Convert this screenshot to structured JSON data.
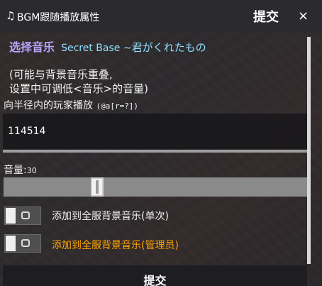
{
  "window": {
    "title": "BGM跟随播放属性",
    "submit_label": "提交",
    "close_label": "×",
    "note_icon": "music-note-icon"
  },
  "form": {
    "select_label": "选择音乐",
    "selected_song_en": "Secret Base ~",
    "selected_song_jp": "君がくれたもの",
    "note_line1": "(可能与背景音乐重叠,",
    "note_line2": " 设置中可调低<音乐>的音量)",
    "radius_label": "向半径内的玩家播放",
    "radius_hint": "(@a[r=?])",
    "radius_value": "114514",
    "volume_label": "音量:",
    "volume_value": "30",
    "volume_fraction": 0.3,
    "toggle1_label": "添加到全服背景音乐(单次)",
    "toggle1_on": false,
    "toggle2_label": "添加到全服背景音乐(管理员)",
    "toggle2_on": false,
    "bottom_submit_label": "提交"
  },
  "colors": {
    "select_label": "#b9a6ff",
    "song": "#8fe0ff",
    "admin_label": "#ffa500",
    "text": "#f0f0f0"
  }
}
